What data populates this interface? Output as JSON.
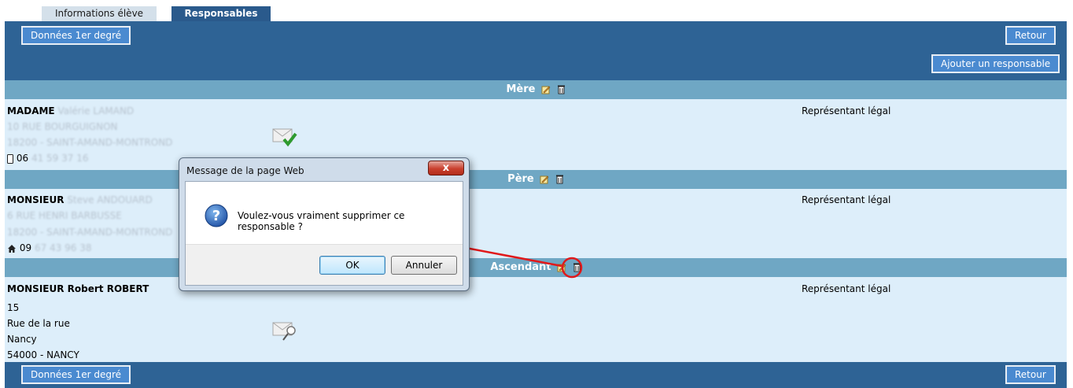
{
  "tabs": {
    "student_info": "Informations élève",
    "guardians": "Responsables"
  },
  "toolbar": {
    "primary_data_label": "Données 1er degré",
    "back_label": "Retour",
    "add_guardian_label": "Ajouter un responsable"
  },
  "sections": {
    "mother": {
      "title": "Mère",
      "civility": "MADAME",
      "name": "Valérie LAMAND",
      "address1": "10 RUE BOURGUIGNON",
      "address2": "18200 - SAINT-AMAND-MONTROND",
      "phone_prefix": "06",
      "phone_rest": "41 59 37 16",
      "status": "Représentant légal"
    },
    "father": {
      "title": "Père",
      "civility": "MONSIEUR",
      "name": "Steve ANDOUARD",
      "address1": "6 RUE HENRI BARBUSSE",
      "address2": "18200 - SAINT-AMAND-MONTROND",
      "phone_prefix": "09",
      "phone_rest": "67 43 96 38",
      "status": "Représentant légal"
    },
    "ascendant": {
      "title": "Ascendant",
      "full_name": "MONSIEUR Robert ROBERT",
      "line1": "15",
      "line2": "Rue de la rue",
      "line3": "Nancy",
      "line4": "54000 - NANCY",
      "status": "Représentant légal"
    }
  },
  "dialog": {
    "title": "Message de la page Web",
    "message": "Voulez-vous vraiment supprimer ce responsable ?",
    "ok_label": "OK",
    "cancel_label": "Annuler",
    "close_glyph": "x"
  },
  "colors": {
    "header_bar": "#2e6395",
    "section_head": "#6fa7c4",
    "row_bg": "#ddeefa",
    "annotation": "#e0191b"
  },
  "icons": [
    "edit-icon",
    "trash-icon",
    "mail-check-icon",
    "mail-search-icon",
    "mobile-phone-icon",
    "home-icon",
    "question-icon",
    "close-icon"
  ]
}
